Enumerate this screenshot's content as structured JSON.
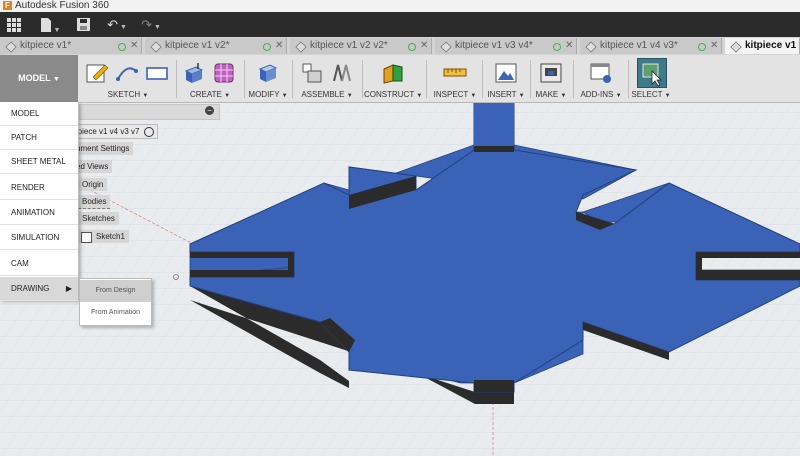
{
  "app": {
    "title": "Autodesk Fusion 360"
  },
  "tabs": [
    {
      "label": "kitpiece v1*",
      "active": false
    },
    {
      "label": "kitpiece v1 v2*",
      "active": false
    },
    {
      "label": "kitpiece v1 v2 v2*",
      "active": false
    },
    {
      "label": "kitpiece v1 v3 v4*",
      "active": false
    },
    {
      "label": "kitpiece v1 v4 v3*",
      "active": false
    },
    {
      "label": "kitpiece v1 v",
      "active": true
    }
  ],
  "toolbar": {
    "workspace_label": "MODEL",
    "groups": {
      "sketch": "SKETCH",
      "create": "CREATE",
      "modify": "MODIFY",
      "assemble": "ASSEMBLE",
      "construct": "CONSTRUCT",
      "inspect": "INSPECT",
      "insert": "INSERT",
      "make": "MAKE",
      "addins": "ADD-INS",
      "select": "SELECT"
    }
  },
  "workspace_menu": {
    "items": [
      "MODEL",
      "PATCH",
      "SHEET METAL",
      "RENDER",
      "ANIMATION",
      "SIMULATION",
      "CAM",
      "DRAWING"
    ],
    "highlighted": "DRAWING",
    "submenu": [
      "From Design",
      "From Animation"
    ],
    "submenu_highlighted": "From Design"
  },
  "browser": {
    "root": "rpiece v1 v4 v3 v7",
    "nodes": [
      "ument Settings",
      "ed Views",
      "Origin",
      "Bodies",
      "Sketches",
      "Sketch1"
    ]
  },
  "colors": {
    "part_top": "#3a63b8",
    "part_side": "#2a2a2a",
    "canvas_bg": "#e9ecef",
    "grid": "#cfd4da",
    "select_active": "#3f7a8a"
  },
  "icons": {
    "grid": "grid-icon",
    "file": "file-icon",
    "save": "save-icon",
    "undo": "undo-icon",
    "redo": "redo-icon"
  }
}
